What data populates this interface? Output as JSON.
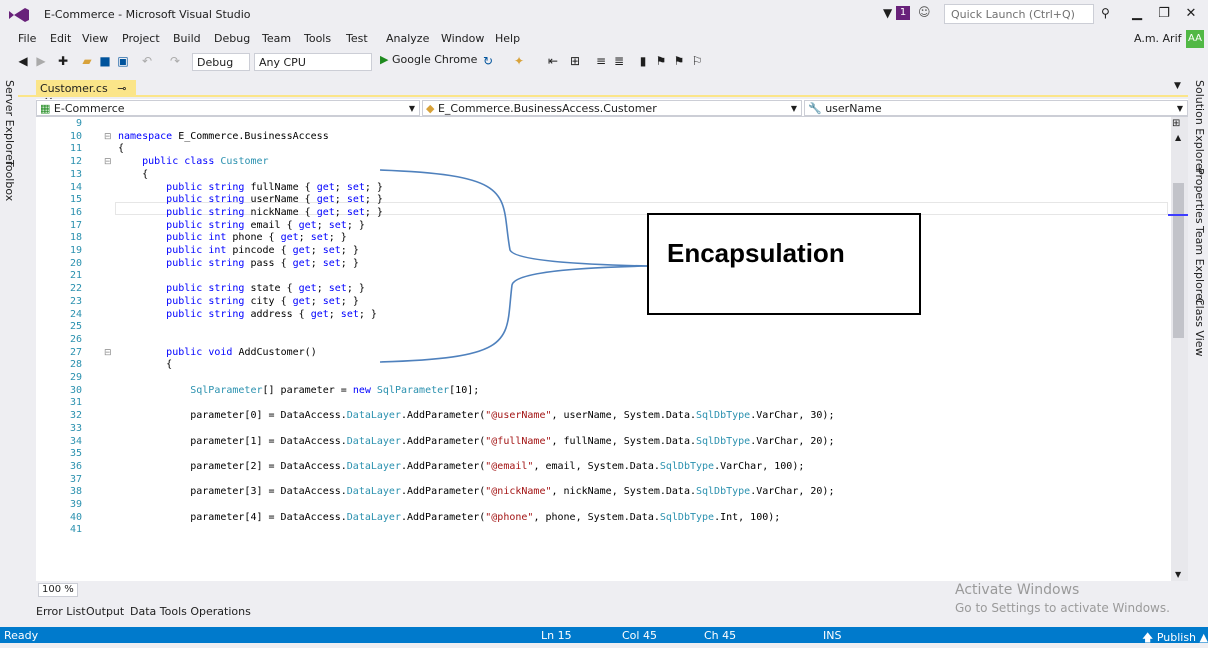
{
  "window": {
    "title": "E-Commerce - Microsoft Visual Studio",
    "notification_count": "1",
    "quick_launch_placeholder": "Quick Launch (Ctrl+Q)"
  },
  "menu": {
    "items": [
      "File",
      "Edit",
      "View",
      "Project",
      "Build",
      "Debug",
      "Team",
      "Tools",
      "Test",
      "Analyze",
      "Window",
      "Help"
    ],
    "user": "A.m. Arif",
    "avatar": "AA"
  },
  "toolbar": {
    "config": "Debug",
    "platform": "Any CPU",
    "run_target": "Google Chrome"
  },
  "side_tabs": {
    "left": [
      "Server Explorer",
      "Toolbox"
    ],
    "right": [
      "Solution Explorer",
      "Properties",
      "Team Explorer",
      "Class View"
    ]
  },
  "doc_tab": {
    "label": "Customer.cs"
  },
  "navbar": {
    "project": "E-Commerce",
    "type": "E_Commerce.BusinessAccess.Customer",
    "member": "userName"
  },
  "code_lines": [
    {
      "n": "9",
      "t": ""
    },
    {
      "n": "10",
      "t": "namespace E_Commerce.BusinessAccess"
    },
    {
      "n": "11",
      "t": "{"
    },
    {
      "n": "12",
      "t": "    public class Customer"
    },
    {
      "n": "13",
      "t": "    {"
    },
    {
      "n": "14",
      "t": "        public string fullName { get; set; }"
    },
    {
      "n": "15",
      "t": "        public string userName { get; set; }"
    },
    {
      "n": "16",
      "t": "        public string nickName { get; set; }"
    },
    {
      "n": "17",
      "t": "        public string email { get; set; }"
    },
    {
      "n": "18",
      "t": "        public int phone { get; set; }"
    },
    {
      "n": "19",
      "t": "        public int pincode { get; set; }"
    },
    {
      "n": "20",
      "t": "        public string pass { get; set; }"
    },
    {
      "n": "21",
      "t": ""
    },
    {
      "n": "22",
      "t": "        public string state { get; set; }"
    },
    {
      "n": "23",
      "t": "        public string city { get; set; }"
    },
    {
      "n": "24",
      "t": "        public string address { get; set; }"
    },
    {
      "n": "25",
      "t": ""
    },
    {
      "n": "26",
      "t": ""
    },
    {
      "n": "27",
      "t": "        public void AddCustomer()"
    },
    {
      "n": "28",
      "t": "        {"
    },
    {
      "n": "29",
      "t": ""
    },
    {
      "n": "30",
      "t": "            SqlParameter[] parameter = new SqlParameter[10];"
    },
    {
      "n": "31",
      "t": ""
    },
    {
      "n": "32",
      "t": "            parameter[0] = DataAccess.DataLayer.AddParameter(\"@userName\", userName, System.Data.SqlDbType.VarChar, 30);"
    },
    {
      "n": "33",
      "t": ""
    },
    {
      "n": "34",
      "t": "            parameter[1] = DataAccess.DataLayer.AddParameter(\"@fullName\", fullName, System.Data.SqlDbType.VarChar, 20);"
    },
    {
      "n": "35",
      "t": ""
    },
    {
      "n": "36",
      "t": "            parameter[2] = DataAccess.DataLayer.AddParameter(\"@email\", email, System.Data.SqlDbType.VarChar, 100);"
    },
    {
      "n": "37",
      "t": ""
    },
    {
      "n": "38",
      "t": "            parameter[3] = DataAccess.DataLayer.AddParameter(\"@nickName\", nickName, System.Data.SqlDbType.VarChar, 20);"
    },
    {
      "n": "39",
      "t": ""
    },
    {
      "n": "40",
      "t": "            parameter[4] = DataAccess.DataLayer.AddParameter(\"@phone\", phone, System.Data.SqlDbType.Int, 100);"
    },
    {
      "n": "41",
      "t": ""
    }
  ],
  "annotation": {
    "label": "Encapsulation"
  },
  "editor": {
    "zoom": "100 %"
  },
  "watermark": {
    "line1": "Activate Windows",
    "line2": "Go to Settings to activate Windows."
  },
  "bottom_tabs": [
    "Error List",
    "Output",
    "Data Tools Operations"
  ],
  "status": {
    "ready": "Ready",
    "ln": "Ln 15",
    "col": "Col 45",
    "ch": "Ch 45",
    "ins": "INS",
    "publish": "Publish"
  }
}
